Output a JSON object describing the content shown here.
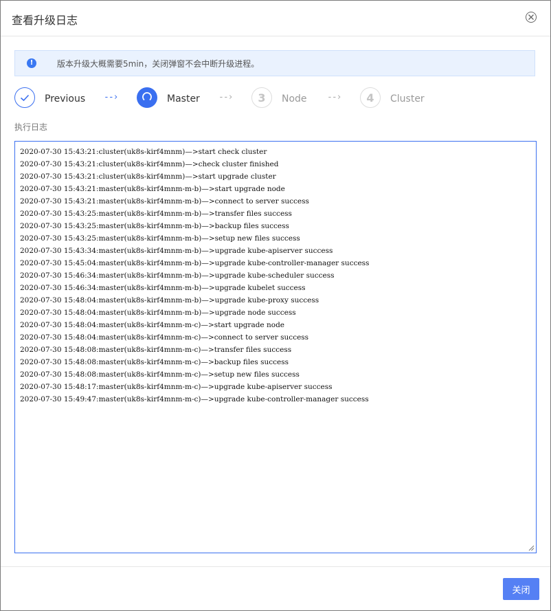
{
  "dialog": {
    "title": "查看升级日志",
    "close_icon": "close-circle-icon"
  },
  "notice": {
    "icon": "info-icon",
    "icon_glyph": "!",
    "text": "版本升级大概需要5min，关闭弹窗不会中断升级进程。"
  },
  "steps": [
    {
      "label": "Previous",
      "status": "done",
      "icon": "check-icon"
    },
    {
      "label": "Master",
      "status": "active",
      "icon": "loading-spinner-icon"
    },
    {
      "label": "Node",
      "status": "pending",
      "number": "3"
    },
    {
      "label": "Cluster",
      "status": "pending",
      "number": "4"
    }
  ],
  "step_separator": "--›",
  "log": {
    "caption": "执行日志",
    "lines": [
      "2020-07-30 15:43:21:cluster(uk8s-kirf4mnm)—>start check cluster",
      "2020-07-30 15:43:21:cluster(uk8s-kirf4mnm)—>check cluster finished",
      "2020-07-30 15:43:21:cluster(uk8s-kirf4mnm)—>start upgrade cluster",
      "2020-07-30 15:43:21:master(uk8s-kirf4mnm-m-b)—>start upgrade node",
      "2020-07-30 15:43:21:master(uk8s-kirf4mnm-m-b)—>connect to server success",
      "2020-07-30 15:43:25:master(uk8s-kirf4mnm-m-b)—>transfer files success",
      "2020-07-30 15:43:25:master(uk8s-kirf4mnm-m-b)—>backup files success",
      "2020-07-30 15:43:25:master(uk8s-kirf4mnm-m-b)—>setup new files success",
      "2020-07-30 15:43:34:master(uk8s-kirf4mnm-m-b)—>upgrade kube-apiserver success",
      "2020-07-30 15:45:04:master(uk8s-kirf4mnm-m-b)—>upgrade kube-controller-manager success",
      "2020-07-30 15:46:34:master(uk8s-kirf4mnm-m-b)—>upgrade kube-scheduler success",
      "2020-07-30 15:46:34:master(uk8s-kirf4mnm-m-b)—>upgrade kubelet success",
      "2020-07-30 15:48:04:master(uk8s-kirf4mnm-m-b)—>upgrade kube-proxy success",
      "2020-07-30 15:48:04:master(uk8s-kirf4mnm-m-b)—>upgrade node success",
      "2020-07-30 15:48:04:master(uk8s-kirf4mnm-m-c)—>start upgrade node",
      "2020-07-30 15:48:04:master(uk8s-kirf4mnm-m-c)—>connect to server success",
      "2020-07-30 15:48:08:master(uk8s-kirf4mnm-m-c)—>transfer files success",
      "2020-07-30 15:48:08:master(uk8s-kirf4mnm-m-c)—>backup files success",
      "2020-07-30 15:48:08:master(uk8s-kirf4mnm-m-c)—>setup new files success",
      "2020-07-30 15:48:17:master(uk8s-kirf4mnm-m-c)—>upgrade kube-apiserver success",
      "2020-07-30 15:49:47:master(uk8s-kirf4mnm-m-c)—>upgrade kube-controller-manager success"
    ]
  },
  "footer": {
    "close_label": "关闭"
  },
  "colors": {
    "accent": "#3a6ff0",
    "button": "#5580f4",
    "notice_bg": "#eaf2fe"
  }
}
